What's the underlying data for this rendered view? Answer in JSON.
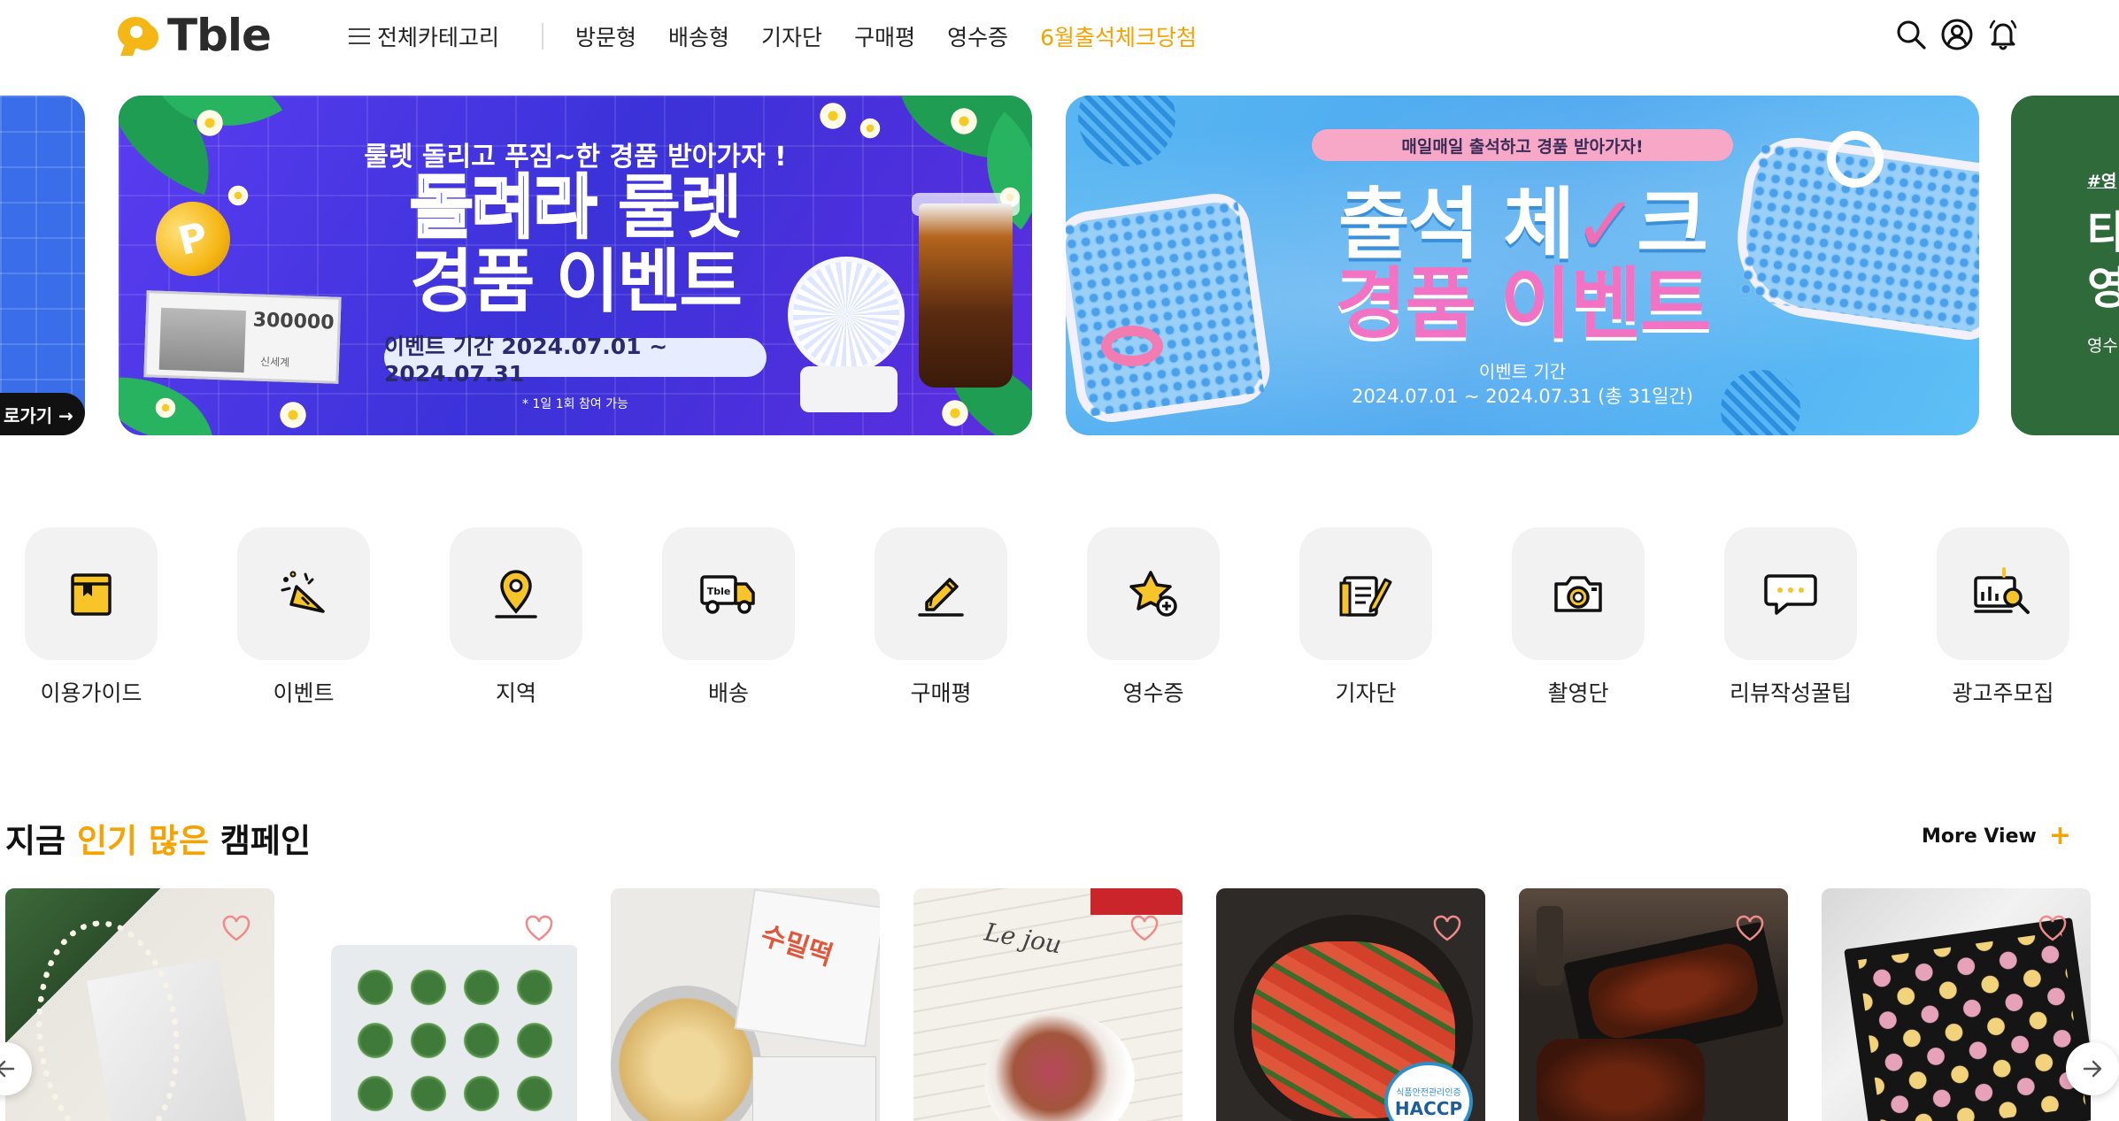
{
  "header": {
    "logo_text": "Tble",
    "all_categories": "전체카테고리",
    "nav": [
      "방문형",
      "배송형",
      "기자단",
      "구매평",
      "영수증",
      "6월출석체크당첨"
    ],
    "icons": [
      "search-icon",
      "user-icon",
      "bell-icon"
    ]
  },
  "banners": {
    "prev": {
      "link": "로가기 →"
    },
    "roulette": {
      "subtitle": "룰렛 돌리고 푸짐~한 경품 받아가자 !",
      "title_em": "돌려라",
      "title_rest": " 룰렛",
      "title2": "경품 이벤트",
      "period": "이벤트 기간 2024.07.01 ~ 2024.07.31",
      "note": "* 1일 1회 참여 가능",
      "coin": "P",
      "voucher_amount": "300000",
      "voucher_brand": "신세계"
    },
    "attendance": {
      "pill": "매일매일 출석하고 경품 받아가자!",
      "title_a": "출석 체",
      "title_check": "✓",
      "title_b": "크",
      "title2": "경품 이벤트",
      "period_label": "이벤트 기간",
      "dates": "2024.07.01 ~ 2024.07.31 (총 31일간)"
    },
    "next": {
      "tag": "#영",
      "big": "타\n영",
      "small": "영수"
    }
  },
  "quick_menu": [
    {
      "label": "이용가이드",
      "icon": "guide-book-icon"
    },
    {
      "label": "이벤트",
      "icon": "party-popper-icon"
    },
    {
      "label": "지역",
      "icon": "location-pin-icon"
    },
    {
      "label": "배송",
      "icon": "delivery-truck-icon"
    },
    {
      "label": "구매평",
      "icon": "pencil-review-icon"
    },
    {
      "label": "영수증",
      "icon": "star-plus-icon"
    },
    {
      "label": "기자단",
      "icon": "notepad-pen-icon"
    },
    {
      "label": "촬영단",
      "icon": "camera-icon"
    },
    {
      "label": "리뷰작성꿀팁",
      "icon": "chat-bubble-icon"
    },
    {
      "label": "광고주모집",
      "icon": "chart-search-icon"
    }
  ],
  "campaign": {
    "title_prefix": "지금 ",
    "title_highlight": "인기 많은",
    "title_suffix": " 캠페인",
    "more_label": "More View",
    "more_plus": "+",
    "cards": [
      {
        "name": "pearl-necklace"
      },
      {
        "name": "green-rice-cakes"
      },
      {
        "name": "tteokbokki-kit",
        "text": "수밀떡"
      },
      {
        "name": "dessert-bowl",
        "text": "Le jou"
      },
      {
        "name": "kimchi",
        "badge": "HACCP",
        "badge_top": "식품안전관리인증"
      },
      {
        "name": "bbq-ribs"
      },
      {
        "name": "rice-cake-gift-box"
      }
    ]
  },
  "colors": {
    "accent": "#f5a300",
    "logo": "#f5b716",
    "icon_yellow": "#f7c52a",
    "heart": "#f08a8a",
    "roulette_bg": "#4a35e6",
    "attendance_bg": "#55b2f2",
    "green_banner": "#2e6a3a"
  }
}
